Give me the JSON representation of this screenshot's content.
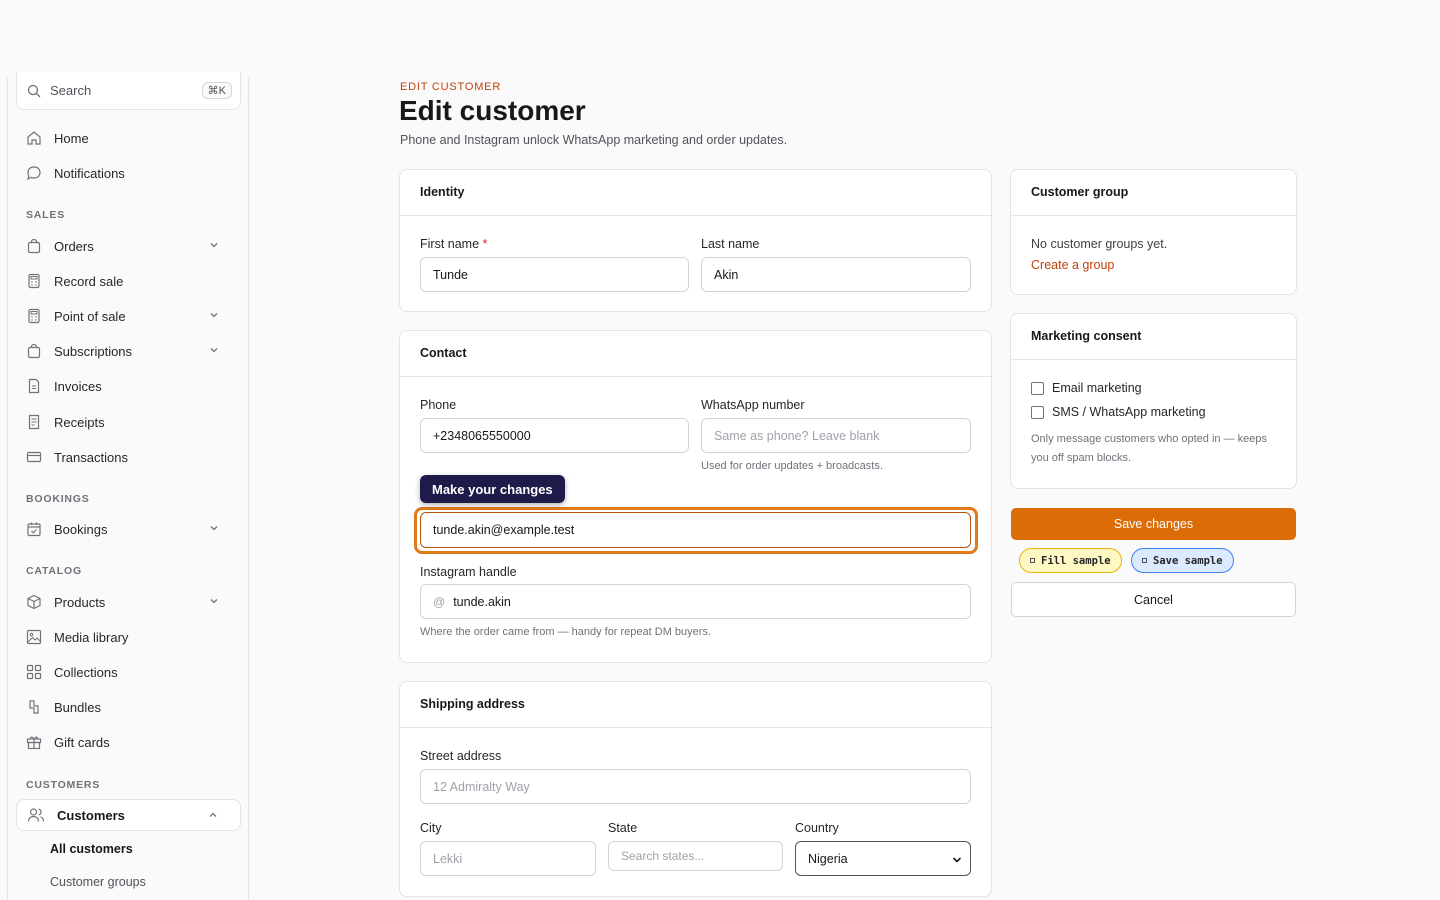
{
  "sidebar": {
    "search": {
      "placeholder": "Search",
      "shortcut": "⌘K"
    },
    "top_items": [
      {
        "label": "Home",
        "icon": "home-icon"
      },
      {
        "label": "Notifications",
        "icon": "chat-bubble-icon"
      }
    ],
    "sections": {
      "sales": "SALES",
      "bookings": "BOOKINGS",
      "catalog": "CATALOG",
      "customers": "CUSTOMERS"
    },
    "sales_items": [
      {
        "label": "Orders",
        "icon": "bag-icon"
      },
      {
        "label": "Record sale",
        "icon": "calculator-icon"
      },
      {
        "label": "Point of sale",
        "icon": "calculator-icon"
      },
      {
        "label": "Subscriptions",
        "icon": "bag-icon"
      },
      {
        "label": "Invoices",
        "icon": "document-icon"
      },
      {
        "label": "Receipts",
        "icon": "receipt-icon"
      },
      {
        "label": "Transactions",
        "icon": "credit-card-icon"
      }
    ],
    "bookings_items": [
      {
        "label": "Bookings",
        "icon": "calendar-icon"
      }
    ],
    "catalog_items": [
      {
        "label": "Products",
        "icon": "cube-icon"
      },
      {
        "label": "Media library",
        "icon": "image-icon"
      },
      {
        "label": "Collections",
        "icon": "grid-icon"
      },
      {
        "label": "Bundles",
        "icon": "bundle-icon"
      },
      {
        "label": "Gift cards",
        "icon": "gift-icon"
      }
    ],
    "customers_item": {
      "label": "Customers",
      "icon": "users-icon"
    },
    "customers_sub": [
      {
        "label": "All customers"
      },
      {
        "label": "Customer groups"
      }
    ]
  },
  "header": {
    "eyebrow": "EDIT CUSTOMER",
    "title": "Edit customer",
    "subtitle": "Phone and Instagram unlock WhatsApp marketing and order updates."
  },
  "identity": {
    "heading": "Identity",
    "first_name_label": "First name",
    "required_mark": "*",
    "first_name_value": "Tunde",
    "last_name_label": "Last name",
    "last_name_value": "Akin"
  },
  "contact": {
    "heading": "Contact",
    "phone_label": "Phone",
    "phone_value": "+2348065550000",
    "whatsapp_label": "WhatsApp number",
    "whatsapp_placeholder": "Same as phone? Leave blank",
    "whatsapp_hint": "Used for order updates + broadcasts.",
    "email_value": "tunde.akin@example.test",
    "instagram_label": "Instagram handle",
    "instagram_prefix": "@",
    "instagram_value": "tunde.akin",
    "instagram_hint": "Where the order came from — handy for repeat DM buyers."
  },
  "tooltip": "Make your changes",
  "shipping": {
    "heading": "Shipping address",
    "street_label": "Street address",
    "street_placeholder": "12 Admiralty Way",
    "city_label": "City",
    "city_placeholder": "Lekki",
    "state_label": "State",
    "state_placeholder": "Search states...",
    "country_label": "Country",
    "country_value": "Nigeria"
  },
  "customer_group": {
    "heading": "Customer group",
    "empty_text": "No customer groups yet.",
    "create_link": "Create a group"
  },
  "marketing": {
    "heading": "Marketing consent",
    "email_option": "Email marketing",
    "sms_option": "SMS / WhatsApp marketing",
    "hint": "Only message customers who opted in — keeps you off spam blocks."
  },
  "actions": {
    "save": "Save changes",
    "fill_sample": "Fill sample",
    "save_sample": "Save sample",
    "cancel": "Cancel"
  },
  "colors": {
    "accent": "#db6c08",
    "link": "#c2410c",
    "tooltip_bg": "#1e1b4b"
  }
}
